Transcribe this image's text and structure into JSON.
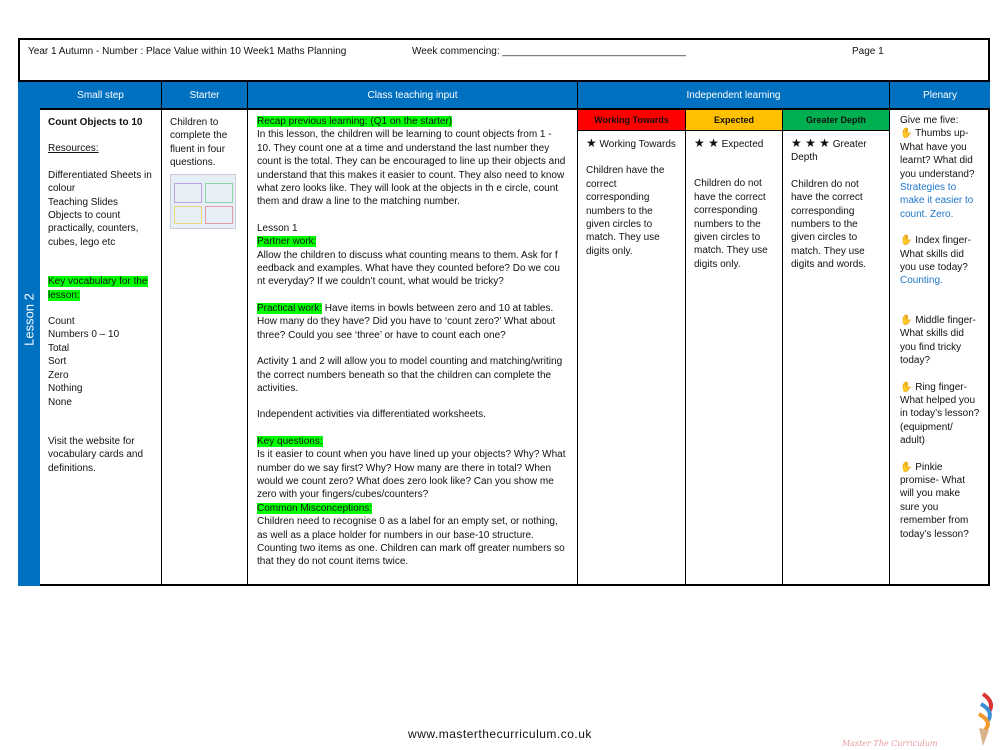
{
  "header": {
    "title": "Year 1 Autumn -  Number : Place Value within 10 Week1 Maths Planning",
    "week": "Week commencing: _________________________________",
    "page": "Page 1"
  },
  "lesson_label": "Lesson 2",
  "columns": {
    "small_step": "Small step",
    "starter": "Starter",
    "class": "Class teaching input",
    "independent": "Independent learning",
    "plenary": "Plenary"
  },
  "levels": [
    {
      "label": "Working Towards",
      "color": "#ff0000",
      "stars": "★",
      "title": "Working Towards",
      "text": "Children have the correct corresponding numbers to the given circles to match. They use digits only."
    },
    {
      "label": "Expected",
      "color": "#ffc000",
      "stars": "★ ★",
      "title": "Expected",
      "text": "Children do not have the correct corresponding numbers to the given circles to match. They use digits only."
    },
    {
      "label": "Greater Depth",
      "color": "#00b050",
      "stars": "★ ★ ★",
      "title": "Greater Depth",
      "text": "Children do not have the correct corresponding numbers to the given circles to match. They use digits and words."
    }
  ],
  "small_step": {
    "title": "Count Objects to 10",
    "resources_label": "Resources:",
    "resources": [
      "Differentiated Sheets in colour",
      "Teaching Slides",
      "Objects to count practically, counters, cubes, lego etc"
    ],
    "vocab_label": "Key vocabulary for the lesson:",
    "vocab": [
      "Count",
      "Numbers 0 – 10",
      "Total",
      "Sort",
      "Zero",
      "Nothing",
      "None"
    ],
    "website": "Visit the website for vocabulary cards and definitions."
  },
  "starter": {
    "text": "Children to complete the fluent in four questions."
  },
  "class": {
    "recap_label": "Recap previous learning: (Q1 on the starter)",
    "recap": "In this lesson, the children will be learning to count objects from 1 - 10. They count one at a time and understand the last number they count is the total. They can be encouraged to line up their objects and understand that this makes it easier to count. They also need to know what zero looks like. They will look at the objects in th e circle, count them and draw a line to the matching number.",
    "lesson1": "Lesson 1",
    "partner_label": "Partner work:",
    "partner": "Allow the children to discuss what counting means to them. Ask for f eedback and examples. What have they counted before? Do we cou nt everyday? If we couldn’t count, what would be tricky?",
    "practical_label": "Practical work:",
    "practical": " Have items in bowls between zero and 10 at tables. How many do they have? Did you have to ‘count zero?’ What about three? Could you see ‘three’ or have to count each one?",
    "activity": "Activity 1 and 2 will allow you to model counting and matching/writing the correct numbers beneath so that the children can complete the activities.",
    "independent": "Independent activities via differentiated worksheets.",
    "key_label": "Key questions:",
    "key": "Is it easier to count when you have lined up your objects? Why? What number do we say first? Why? How many are there in total? When would we count zero? What does zero look like? Can you show me zero with your fingers/cubes/counters?",
    "misc_label": "Common Misconceptions:",
    "misc": "Children need to recognise 0 as a label for an empty set, or nothing, as well as a place holder for numbers in our base-10 structure. Counting two items as one. Children can mark off greater numbers so that they do not count items twice."
  },
  "plenary": {
    "intro": "Give me five:",
    "items": [
      {
        "text": "Thumbs up- What have you learnt? What did you understand?",
        "answer": "Strategies to make it easier to count. Zero."
      },
      {
        "text": "Index finger- What skills did you use today?",
        "answer": "Counting."
      },
      {
        "text": "Middle finger- What skills did you find tricky today?",
        "answer": ""
      },
      {
        "text": "Ring finger- What helped you in today’s lesson? (equipment/ adult)",
        "answer": ""
      },
      {
        "text": "Pinkie promise- What will you make sure you remember from today’s lesson?",
        "answer": ""
      }
    ]
  },
  "footer": {
    "url": "www.masterthecurriculum.co.uk",
    "logo_text": "Master The Curriculum"
  }
}
